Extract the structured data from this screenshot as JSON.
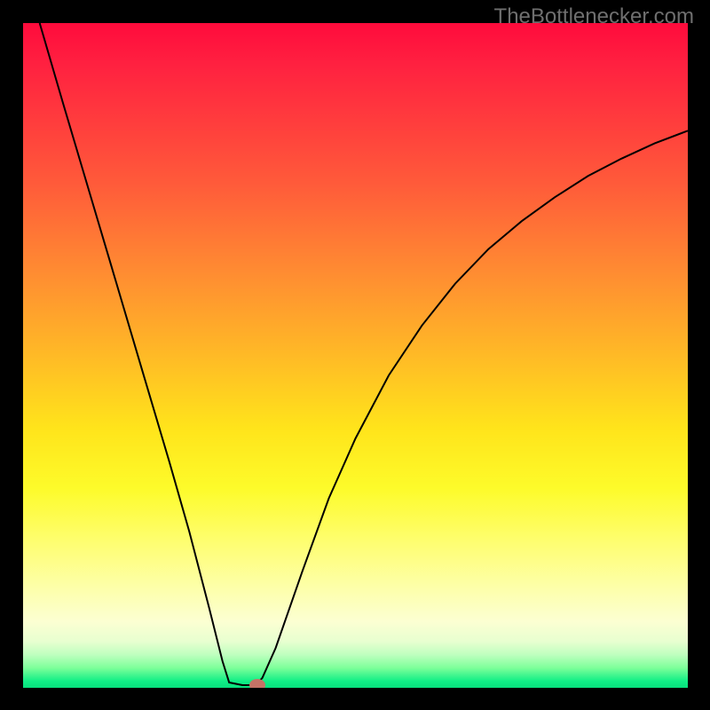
{
  "watermark": "TheBottlenecker.com",
  "chart_data": {
    "type": "line",
    "title": "",
    "xlabel": "",
    "ylabel": "",
    "xlim": [
      0,
      1
    ],
    "ylim": [
      0,
      1
    ],
    "gradient_stops": [
      {
        "pos": 0.0,
        "color": "#ff0b3c"
      },
      {
        "pos": 0.06,
        "color": "#ff2040"
      },
      {
        "pos": 0.24,
        "color": "#ff5a3a"
      },
      {
        "pos": 0.37,
        "color": "#ff8a32"
      },
      {
        "pos": 0.49,
        "color": "#ffb627"
      },
      {
        "pos": 0.61,
        "color": "#ffe41b"
      },
      {
        "pos": 0.7,
        "color": "#fdfb2a"
      },
      {
        "pos": 0.78,
        "color": "#fefe70"
      },
      {
        "pos": 0.85,
        "color": "#fdffaa"
      },
      {
        "pos": 0.9,
        "color": "#fcffd2"
      },
      {
        "pos": 0.93,
        "color": "#e8ffd0"
      },
      {
        "pos": 0.95,
        "color": "#bfffbf"
      },
      {
        "pos": 0.97,
        "color": "#7dff9a"
      },
      {
        "pos": 0.99,
        "color": "#10ef86"
      },
      {
        "pos": 1.0,
        "color": "#08e07d"
      }
    ],
    "series": [
      {
        "name": "curve",
        "points_norm": [
          {
            "x": 0.025,
            "y": 1.0
          },
          {
            "x": 0.06,
            "y": 0.88
          },
          {
            "x": 0.1,
            "y": 0.745
          },
          {
            "x": 0.14,
            "y": 0.61
          },
          {
            "x": 0.18,
            "y": 0.475
          },
          {
            "x": 0.22,
            "y": 0.34
          },
          {
            "x": 0.25,
            "y": 0.235
          },
          {
            "x": 0.28,
            "y": 0.12
          },
          {
            "x": 0.3,
            "y": 0.04
          },
          {
            "x": 0.31,
            "y": 0.008
          },
          {
            "x": 0.33,
            "y": 0.004
          },
          {
            "x": 0.35,
            "y": 0.004
          },
          {
            "x": 0.36,
            "y": 0.015
          },
          {
            "x": 0.38,
            "y": 0.06
          },
          {
            "x": 0.42,
            "y": 0.175
          },
          {
            "x": 0.46,
            "y": 0.285
          },
          {
            "x": 0.5,
            "y": 0.375
          },
          {
            "x": 0.55,
            "y": 0.47
          },
          {
            "x": 0.6,
            "y": 0.545
          },
          {
            "x": 0.65,
            "y": 0.608
          },
          {
            "x": 0.7,
            "y": 0.66
          },
          {
            "x": 0.75,
            "y": 0.702
          },
          {
            "x": 0.8,
            "y": 0.738
          },
          {
            "x": 0.85,
            "y": 0.77
          },
          {
            "x": 0.9,
            "y": 0.796
          },
          {
            "x": 0.95,
            "y": 0.819
          },
          {
            "x": 1.0,
            "y": 0.838
          }
        ]
      }
    ],
    "marker": {
      "x_norm": 0.353,
      "y_norm": 0.004
    }
  }
}
